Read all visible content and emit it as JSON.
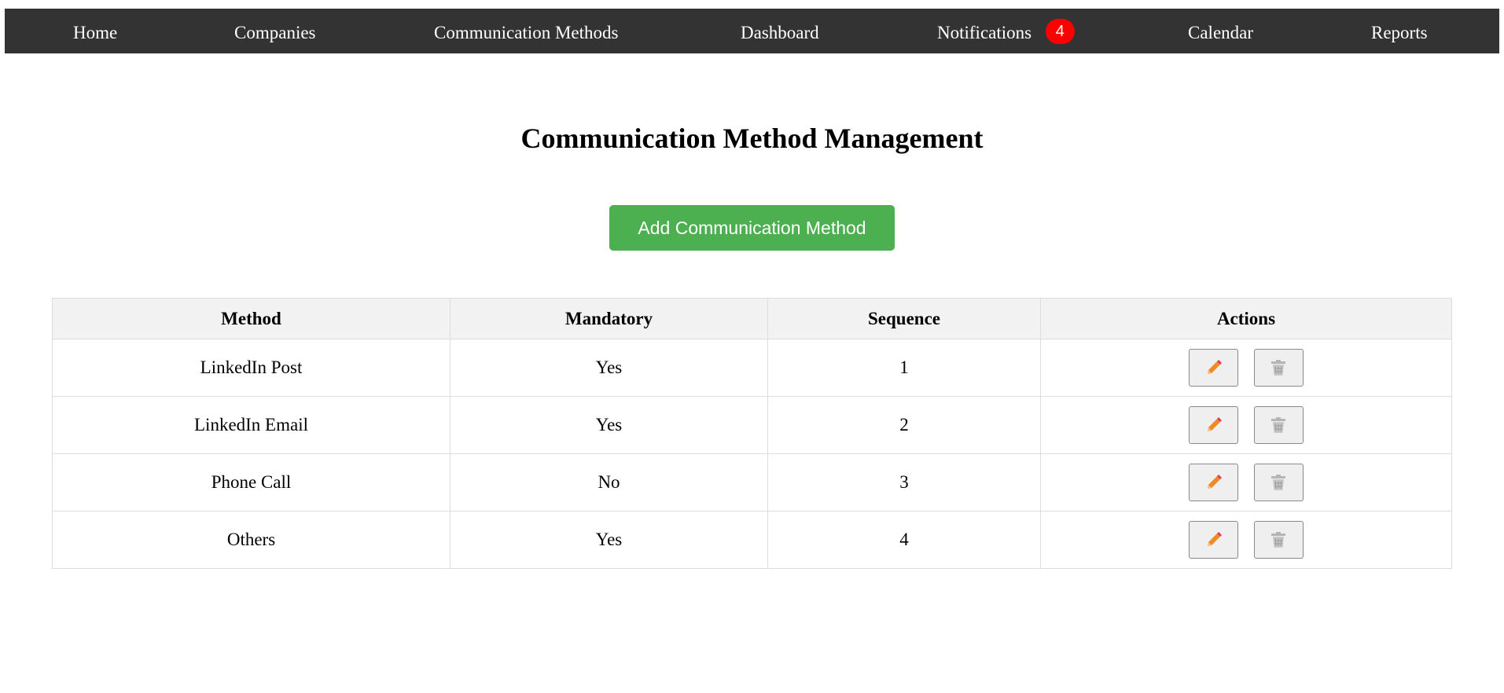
{
  "nav": {
    "items": [
      {
        "label": "Home"
      },
      {
        "label": "Companies"
      },
      {
        "label": "Communication Methods"
      },
      {
        "label": "Dashboard"
      },
      {
        "label": "Notifications",
        "badge": "4"
      },
      {
        "label": "Calendar"
      },
      {
        "label": "Reports"
      }
    ]
  },
  "main": {
    "title": "Communication Method Management",
    "add_button_label": "Add Communication Method"
  },
  "table": {
    "headers": [
      "Method",
      "Mandatory",
      "Sequence",
      "Actions"
    ],
    "rows": [
      {
        "method": "LinkedIn Post",
        "mandatory": "Yes",
        "sequence": "1"
      },
      {
        "method": "LinkedIn Email",
        "mandatory": "Yes",
        "sequence": "2"
      },
      {
        "method": "Phone Call",
        "mandatory": "No",
        "sequence": "3"
      },
      {
        "method": "Others",
        "mandatory": "Yes",
        "sequence": "4"
      }
    ],
    "actions": {
      "edit_icon": "pencil-icon",
      "delete_icon": "trash-icon"
    }
  },
  "colors": {
    "navbar": "#333333",
    "badge": "#ff0000",
    "add_button": "#4caf50",
    "header_bg": "#f2f2f2",
    "border": "#dddddd",
    "pencil": "#f08a24",
    "trash": "#aaaaaa"
  }
}
